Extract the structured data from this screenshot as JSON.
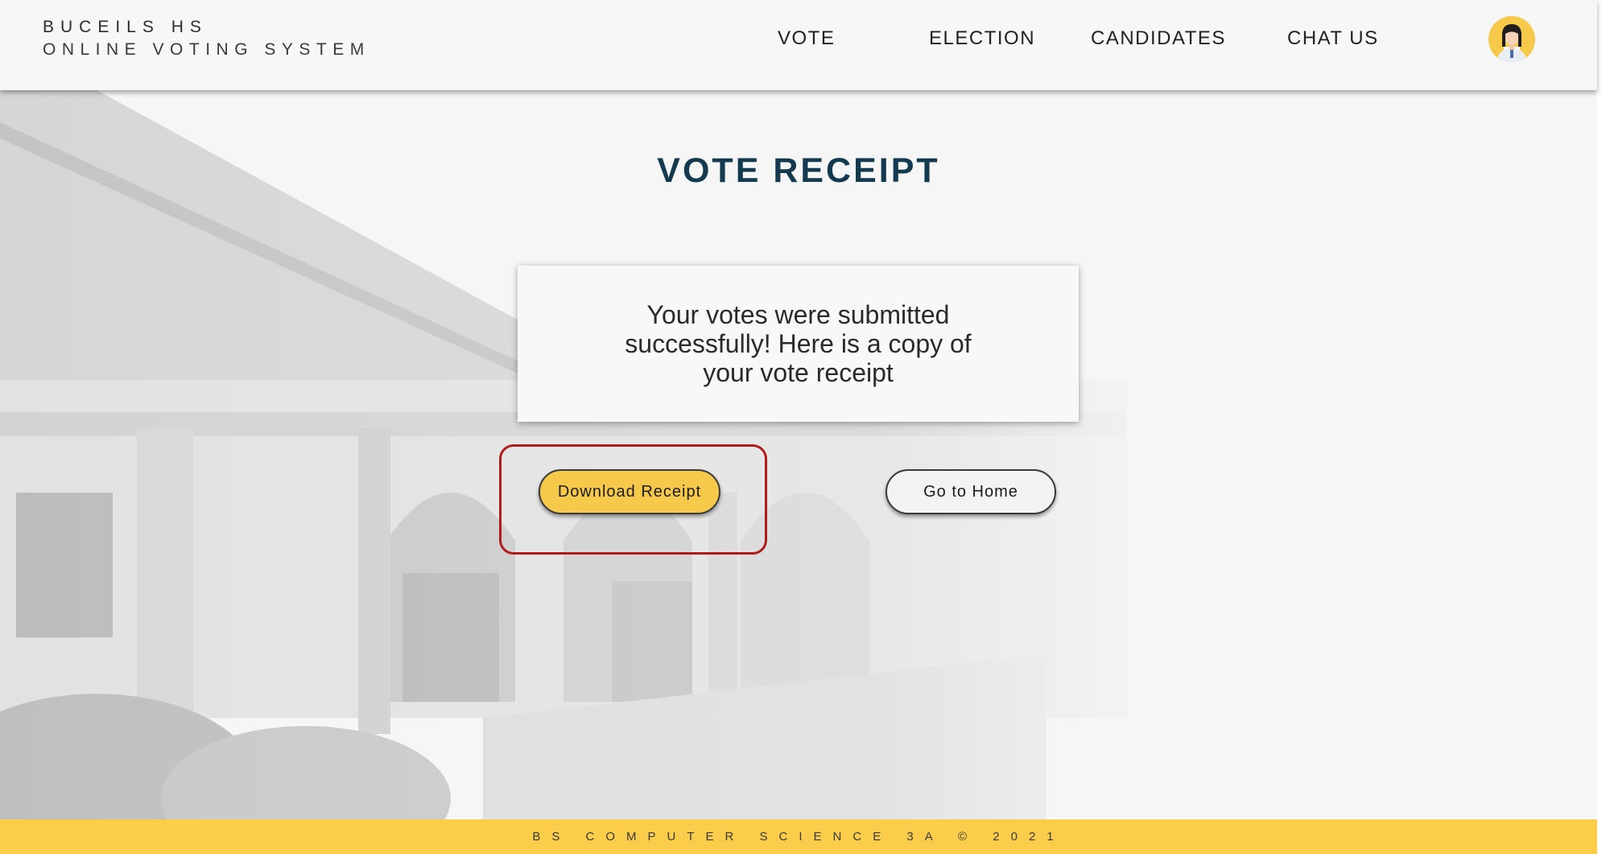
{
  "header": {
    "brand_line1": "BUCEILS HS",
    "brand_line2": "ONLINE VOTING SYSTEM",
    "nav": [
      "VOTE",
      "ELECTION",
      "CANDIDATES",
      "CHAT US"
    ],
    "avatar_icon": "user-avatar-icon"
  },
  "main": {
    "title": "VOTE RECEIPT",
    "message": "Your votes were submitted successfully! Here is a copy of your vote receipt",
    "download_label": "Download Receipt",
    "home_label": "Go to Home"
  },
  "footer": {
    "text": "BS COMPUTER SCIENCE 3A © 2021"
  },
  "colors": {
    "accent": "#fccd4a",
    "title": "#143a4f",
    "highlight": "#b01b1b"
  }
}
